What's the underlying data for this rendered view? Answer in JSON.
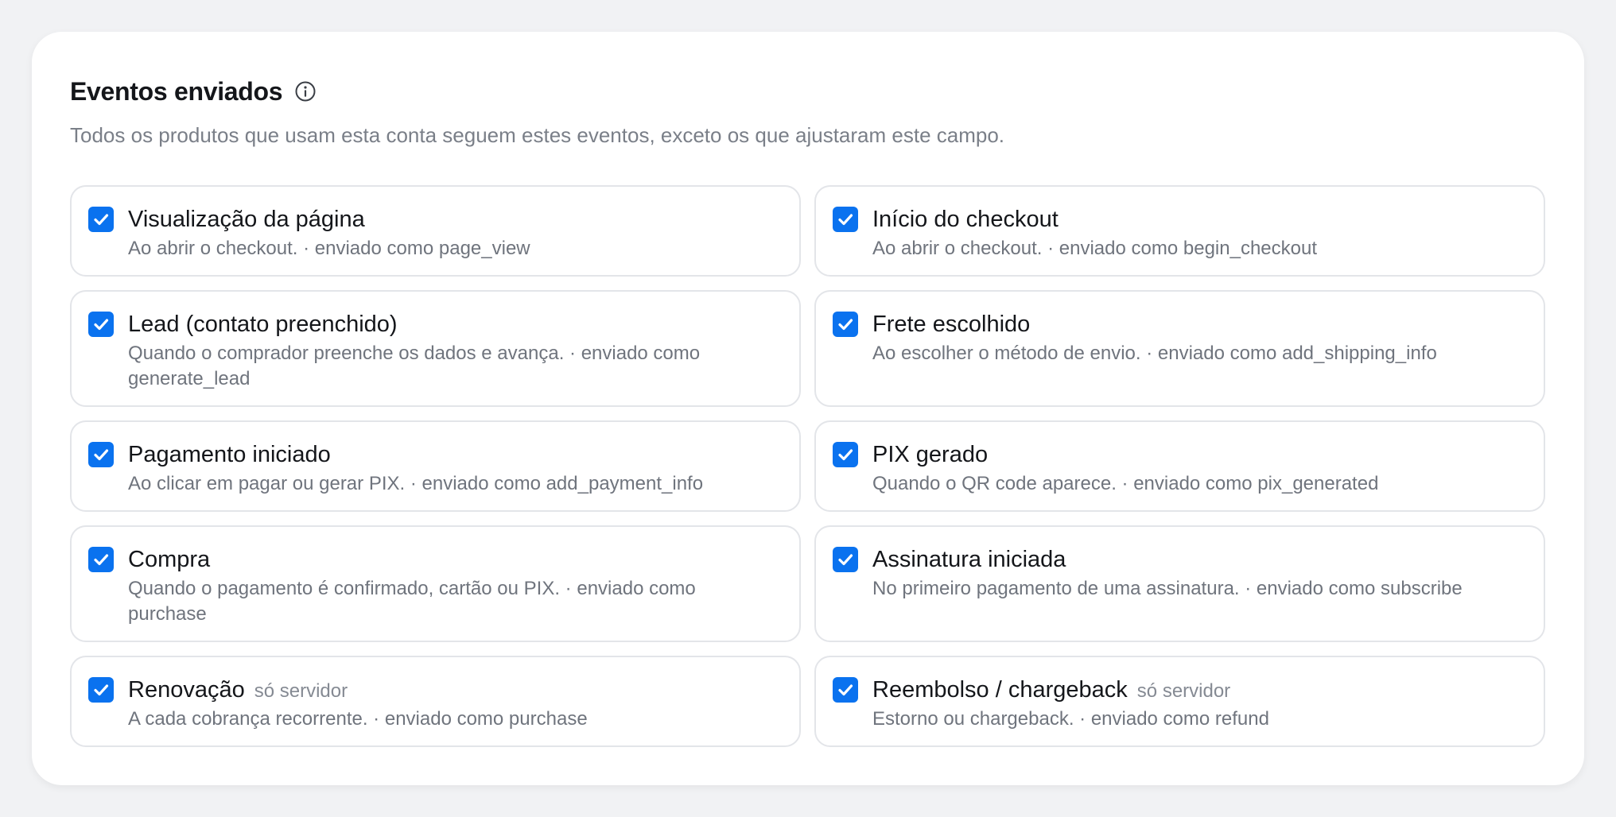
{
  "section": {
    "title": "Eventos enviados",
    "subtitle": "Todos os produtos que usam esta conta seguem estes eventos, exceto os que ajustaram este campo.",
    "info_icon": "info-icon"
  },
  "accent_color": "#0a72ef",
  "events": [
    {
      "id": "page-view",
      "title": "Visualização da página",
      "tag": "",
      "description": "Ao abrir o checkout. · enviado como page_view",
      "checked": true
    },
    {
      "id": "begin-checkout",
      "title": "Início do checkout",
      "tag": "",
      "description": "Ao abrir o checkout. · enviado como begin_checkout",
      "checked": true
    },
    {
      "id": "lead",
      "title": "Lead (contato preenchido)",
      "tag": "",
      "description": "Quando o comprador preenche os dados e avança. · enviado como generate_lead",
      "checked": true
    },
    {
      "id": "shipping",
      "title": "Frete escolhido",
      "tag": "",
      "description": "Ao escolher o método de envio. · enviado como add_shipping_info",
      "checked": true
    },
    {
      "id": "payment",
      "title": "Pagamento iniciado",
      "tag": "",
      "description": "Ao clicar em pagar ou gerar PIX. · enviado como add_payment_info",
      "checked": true
    },
    {
      "id": "pix",
      "title": "PIX gerado",
      "tag": "",
      "description": "Quando o QR code aparece. · enviado como pix_generated",
      "checked": true
    },
    {
      "id": "purchase",
      "title": "Compra",
      "tag": "",
      "description": "Quando o pagamento é confirmado, cartão ou PIX. · enviado como purchase",
      "checked": true
    },
    {
      "id": "subscribe",
      "title": "Assinatura iniciada",
      "tag": "",
      "description": "No primeiro pagamento de uma assinatura. · enviado como subscribe",
      "checked": true
    },
    {
      "id": "renewal",
      "title": "Renovação",
      "tag": "só servidor",
      "description": "A cada cobrança recorrente. · enviado como purchase",
      "checked": true
    },
    {
      "id": "refund",
      "title": "Reembolso / chargeback",
      "tag": "só servidor",
      "description": "Estorno ou chargeback. · enviado como refund",
      "checked": true
    }
  ]
}
